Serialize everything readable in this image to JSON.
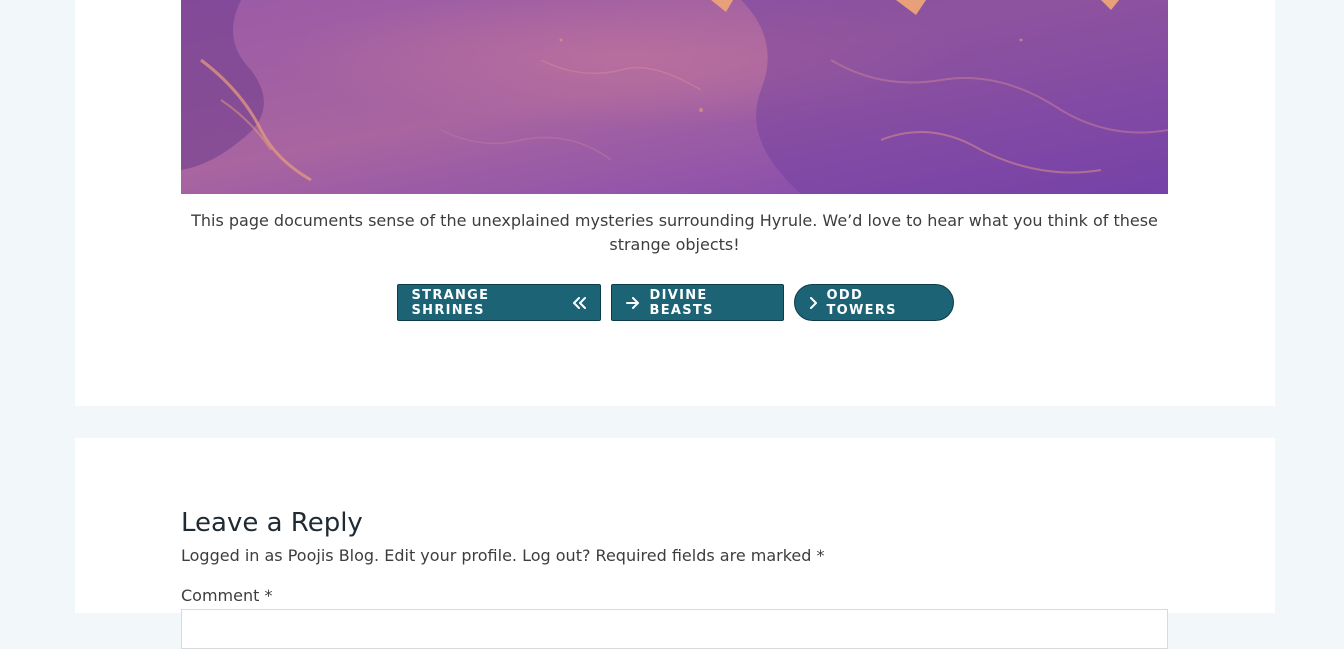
{
  "article": {
    "caption": "This page documents sense of the unexplained mysteries surrounding Hyrule. We’d love to hear what you think of these strange objects!"
  },
  "buttons": [
    {
      "label": "STRANGE SHRINES",
      "icon": "double-chevron-left-icon"
    },
    {
      "label": "DIVINE BEASTS",
      "icon": "arrow-right-icon"
    },
    {
      "label": "ODD TOWERS",
      "icon": "chevron-right-icon"
    }
  ],
  "comments": {
    "title": "Leave a Reply",
    "logged_in_prefix": "Logged in as Poojis Blog.",
    "edit_profile_link": "Edit your profile.",
    "log_out_link": "Log out?",
    "required_note": "Required fields are marked",
    "required_mark": "*",
    "comment_label": "Comment",
    "comment_required_mark": "*"
  },
  "colors": {
    "page_background": "#f2f7fa",
    "card_background": "#ffffff",
    "button_background": "#1b6375",
    "hero_tint": "#8a4fb0",
    "hero_accent": "#e8a07a"
  }
}
